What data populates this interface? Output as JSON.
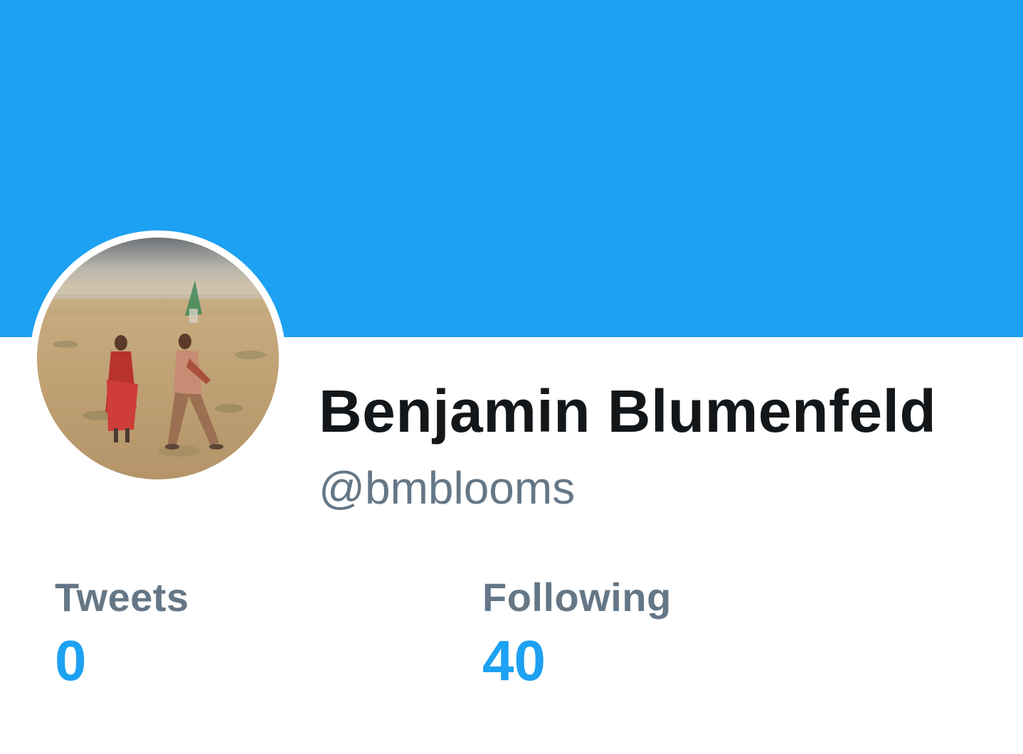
{
  "profile": {
    "display_name": "Benjamin Blumenfeld",
    "handle": "@bmblooms",
    "banner_color": "#1da1f2",
    "avatar_alt": "profile-photo"
  },
  "stats": {
    "tweets": {
      "label": "Tweets",
      "value": "0"
    },
    "following": {
      "label": "Following",
      "value": "40"
    }
  },
  "colors": {
    "accent": "#1da1f2",
    "name_text": "#14171a",
    "secondary_text": "#657786"
  }
}
